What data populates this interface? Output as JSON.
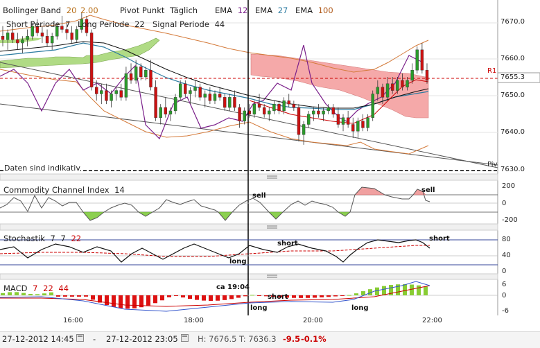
{
  "colors": {
    "ema12": "#7a1f8a",
    "ema27": "#2a7aa0",
    "ema100": "#b05a1a",
    "accent_red": "#cc0000",
    "bull": "#2a9a2a",
    "bear": "#cc1111"
  },
  "legend": {
    "row1": [
      {
        "name": "Bollinger Band",
        "params": [
          "20",
          "2.00"
        ]
      },
      {
        "name": "Pivot Punkt",
        "params": [
          "Täglich"
        ]
      },
      {
        "name": "EMA",
        "params": [
          "12"
        ]
      },
      {
        "name": "EMA",
        "params": [
          "27"
        ]
      },
      {
        "name": "EMA",
        "params": [
          "100"
        ]
      }
    ],
    "row2": [
      {
        "name": "Short Periode",
        "params": [
          "7"
        ]
      },
      {
        "name": "Long Periode",
        "params": [
          "22"
        ]
      },
      {
        "name": "Signal Periode",
        "params": [
          "44"
        ]
      }
    ]
  },
  "main": {
    "disclaimer": "Daten sind indikativ",
    "pivot_r1": "R1",
    "pivot_label": "Piv",
    "current_price": "7655.3",
    "y_ticks": [
      "7670.0",
      "7660.0",
      "7650.0",
      "7640.0",
      "7630.0"
    ]
  },
  "cci": {
    "title": "Commodity Channel Index",
    "param": "14",
    "y_ticks": [
      "200",
      "0",
      "-200"
    ],
    "annotations": [
      "sell",
      "sell"
    ]
  },
  "stoch": {
    "title": "Stochastik",
    "params": [
      "7",
      "7",
      "22"
    ],
    "y_ticks": [
      "80",
      "40",
      "0"
    ],
    "annotations": [
      "short",
      "long",
      "short"
    ]
  },
  "macd": {
    "title": "MACD",
    "params": [
      "7",
      "22",
      "44"
    ],
    "y_ticks": [
      "6",
      "0",
      "-6"
    ],
    "annotations": [
      "ca 19:04",
      "short",
      "long",
      "long"
    ]
  },
  "time_axis": [
    "16:00",
    "18:00",
    "20:00",
    "22:00"
  ],
  "footer": {
    "from": "27-12-2012 14:45",
    "dash": "-",
    "to": "27-12-2012 23:05",
    "high": "H: 7676.5",
    "low": "T: 7636.3",
    "change": "-9.5",
    "change_pct": "-0.1%"
  },
  "chart_data": {
    "type": "candlestick",
    "y_range": [
      7628,
      7675
    ],
    "x_ticks": [
      "16:00",
      "18:00",
      "20:00",
      "22:00"
    ],
    "candles": [
      [
        7668,
        7671,
        7665,
        7667
      ],
      [
        7667,
        7670,
        7664,
        7669
      ],
      [
        7669,
        7671,
        7666,
        7667
      ],
      [
        7667,
        7669,
        7664,
        7666
      ],
      [
        7666,
        7668,
        7663,
        7667
      ],
      [
        7667,
        7670,
        7665,
        7668
      ],
      [
        7668,
        7672,
        7667,
        7671
      ],
      [
        7671,
        7673,
        7668,
        7669
      ],
      [
        7669,
        7671,
        7666,
        7668
      ],
      [
        7668,
        7670,
        7665,
        7666
      ],
      [
        7666,
        7669,
        7664,
        7668
      ],
      [
        7668,
        7672,
        7667,
        7671
      ],
      [
        7671,
        7674,
        7669,
        7670
      ],
      [
        7670,
        7672,
        7667,
        7669
      ],
      [
        7669,
        7671,
        7666,
        7667
      ],
      [
        7667,
        7671,
        7666,
        7670
      ],
      [
        7670,
        7675,
        7669,
        7673
      ],
      [
        7673,
        7674,
        7668,
        7669
      ],
      [
        7669,
        7670,
        7652,
        7653
      ],
      [
        7653,
        7655,
        7649,
        7651
      ],
      [
        7651,
        7654,
        7648,
        7652
      ],
      [
        7652,
        7654,
        7648,
        7649
      ],
      [
        7649,
        7652,
        7647,
        7651
      ],
      [
        7651,
        7653,
        7649,
        7652
      ],
      [
        7652,
        7654,
        7649,
        7650
      ],
      [
        7650,
        7659,
        7649,
        7657
      ],
      [
        7657,
        7660,
        7654,
        7655
      ],
      [
        7655,
        7661,
        7654,
        7659
      ],
      [
        7659,
        7660,
        7655,
        7656
      ],
      [
        7656,
        7659,
        7655,
        7658
      ],
      [
        7658,
        7661,
        7652,
        7653
      ],
      [
        7653,
        7655,
        7643,
        7644
      ],
      [
        7644,
        7648,
        7642,
        7647
      ],
      [
        7647,
        7650,
        7644,
        7645
      ],
      [
        7645,
        7647,
        7643,
        7646
      ],
      [
        7646,
        7651,
        7645,
        7650
      ],
      [
        7650,
        7655,
        7649,
        7654
      ],
      [
        7654,
        7655,
        7650,
        7651
      ],
      [
        7651,
        7653,
        7648,
        7652
      ],
      [
        7652,
        7655,
        7650,
        7653
      ],
      [
        7653,
        7654,
        7649,
        7650
      ],
      [
        7650,
        7652,
        7647,
        7651
      ],
      [
        7651,
        7653,
        7648,
        7649
      ],
      [
        7649,
        7652,
        7648,
        7651
      ],
      [
        7651,
        7653,
        7649,
        7650
      ],
      [
        7650,
        7651,
        7646,
        7647
      ],
      [
        7647,
        7651,
        7646,
        7650
      ],
      [
        7650,
        7652,
        7646,
        7647
      ],
      [
        7647,
        7648,
        7641,
        7643
      ],
      [
        7643,
        7647,
        7642,
        7646
      ],
      [
        7646,
        7648,
        7644,
        7645
      ],
      [
        7645,
        7649,
        7644,
        7648
      ],
      [
        7648,
        7651,
        7646,
        7647
      ],
      [
        7647,
        7648,
        7644,
        7645
      ],
      [
        7645,
        7647,
        7643,
        7646
      ],
      [
        7646,
        7649,
        7645,
        7648
      ],
      [
        7648,
        7649,
        7645,
        7646
      ],
      [
        7646,
        7650,
        7645,
        7649
      ],
      [
        7649,
        7651,
        7647,
        7648
      ],
      [
        7648,
        7649,
        7646,
        7647
      ],
      [
        7647,
        7648,
        7637,
        7639
      ],
      [
        7639,
        7643,
        7636,
        7642
      ],
      [
        7642,
        7646,
        7641,
        7645
      ],
      [
        7645,
        7647,
        7643,
        7646
      ],
      [
        7646,
        7648,
        7644,
        7645
      ],
      [
        7645,
        7647,
        7643,
        7646
      ],
      [
        7646,
        7648,
        7645,
        7647
      ],
      [
        7647,
        7648,
        7644,
        7645
      ],
      [
        7645,
        7647,
        7641,
        7642
      ],
      [
        7642,
        7645,
        7640,
        7644
      ],
      [
        7644,
        7646,
        7641,
        7642
      ],
      [
        7642,
        7644,
        7638,
        7640
      ],
      [
        7640,
        7644,
        7638,
        7643
      ],
      [
        7643,
        7645,
        7640,
        7641
      ],
      [
        7641,
        7645,
        7640,
        7644
      ],
      [
        7644,
        7652,
        7643,
        7651
      ],
      [
        7651,
        7655,
        7649,
        7653
      ],
      [
        7653,
        7654,
        7648,
        7650
      ],
      [
        7650,
        7656,
        7649,
        7654
      ],
      [
        7654,
        7656,
        7651,
        7652
      ],
      [
        7652,
        7656,
        7651,
        7655
      ],
      [
        7655,
        7657,
        7652,
        7653
      ],
      [
        7653,
        7656,
        7652,
        7655
      ],
      [
        7655,
        7660,
        7654,
        7658
      ],
      [
        7658,
        7665,
        7657,
        7664
      ],
      [
        7664,
        7666,
        7657,
        7658
      ],
      [
        7658,
        7660,
        7654,
        7655
      ]
    ]
  }
}
